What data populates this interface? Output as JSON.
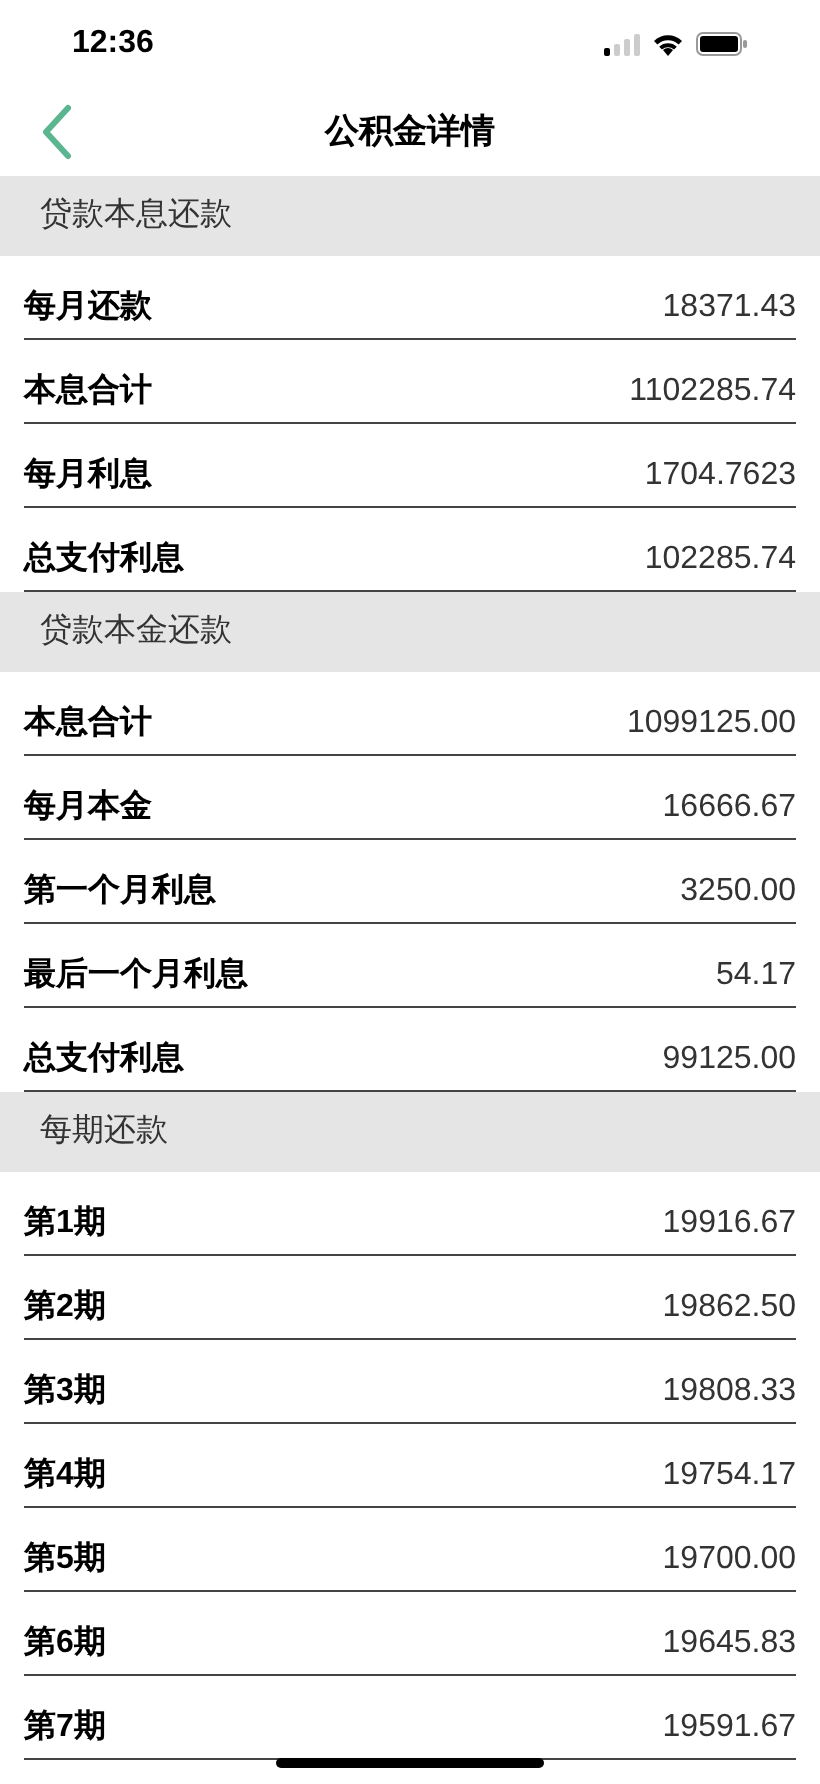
{
  "status_bar": {
    "time": "12:36"
  },
  "nav": {
    "title": "公积金详情"
  },
  "sections": [
    {
      "title": "贷款本息还款",
      "rows": [
        {
          "label": "每月还款",
          "value": "18371.43"
        },
        {
          "label": "本息合计",
          "value": "1102285.74"
        },
        {
          "label": "每月利息",
          "value": "1704.7623"
        },
        {
          "label": "总支付利息",
          "value": "102285.74"
        }
      ]
    },
    {
      "title": "贷款本金还款",
      "rows": [
        {
          "label": "本息合计",
          "value": "1099125.00"
        },
        {
          "label": "每月本金",
          "value": "16666.67"
        },
        {
          "label": "第一个月利息",
          "value": "3250.00"
        },
        {
          "label": "最后一个月利息",
          "value": "54.17"
        },
        {
          "label": "总支付利息",
          "value": "99125.00"
        }
      ]
    },
    {
      "title": "每期还款",
      "rows": [
        {
          "label": "第1期",
          "value": "19916.67"
        },
        {
          "label": "第2期",
          "value": "19862.50"
        },
        {
          "label": "第3期",
          "value": "19808.33"
        },
        {
          "label": "第4期",
          "value": "19754.17"
        },
        {
          "label": "第5期",
          "value": "19700.00"
        },
        {
          "label": "第6期",
          "value": "19645.83"
        },
        {
          "label": "第7期",
          "value": "19591.67"
        }
      ]
    }
  ]
}
